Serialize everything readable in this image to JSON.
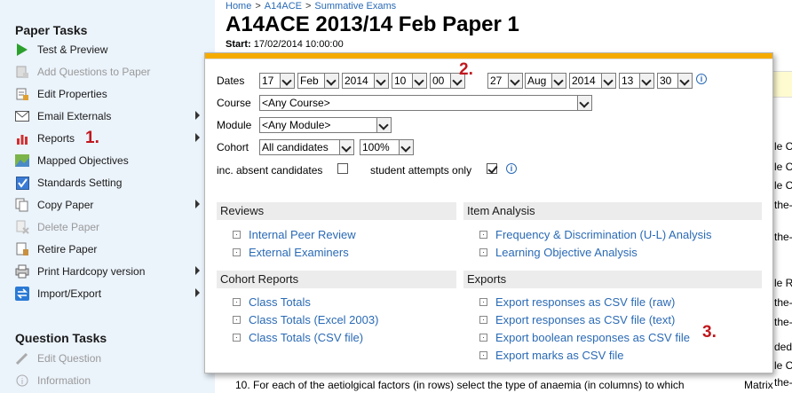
{
  "breadcrumb": {
    "items": [
      "Home",
      "A14ACE",
      "Summative Exams"
    ]
  },
  "header": {
    "title": "A14ACE 2013/14 Feb Paper 1",
    "start_label": "Start:",
    "start_value": "17/02/2014 10:00:00"
  },
  "sidebar": {
    "paper_tasks_title": "Paper Tasks",
    "paper_items": [
      {
        "label": "Test & Preview",
        "icon": "play-icon",
        "disabled": false,
        "submenu": false
      },
      {
        "label": "Add Questions to Paper",
        "icon": "add-questions-icon",
        "disabled": true,
        "submenu": false
      },
      {
        "label": "Edit Properties",
        "icon": "edit-properties-icon",
        "disabled": false,
        "submenu": false
      },
      {
        "label": "Email Externals",
        "icon": "email-icon",
        "disabled": false,
        "submenu": true
      },
      {
        "label": "Reports",
        "icon": "bar-chart-icon",
        "disabled": false,
        "submenu": true
      },
      {
        "label": "Mapped Objectives",
        "icon": "map-icon",
        "disabled": false,
        "submenu": false
      },
      {
        "label": "Standards Setting",
        "icon": "checkbox-icon",
        "disabled": false,
        "submenu": false
      },
      {
        "label": "Copy Paper",
        "icon": "copy-icon",
        "disabled": false,
        "submenu": true
      },
      {
        "label": "Delete Paper",
        "icon": "delete-icon",
        "disabled": true,
        "submenu": false
      },
      {
        "label": "Retire Paper",
        "icon": "retire-icon",
        "disabled": false,
        "submenu": false
      },
      {
        "label": "Print Hardcopy version",
        "icon": "print-icon",
        "disabled": false,
        "submenu": true
      },
      {
        "label": "Import/Export",
        "icon": "import-export-icon",
        "disabled": false,
        "submenu": true
      }
    ],
    "question_tasks_title": "Question Tasks",
    "question_items": [
      {
        "label": "Edit Question",
        "icon": "pencil-icon",
        "disabled": true
      },
      {
        "label": "Information",
        "icon": "info-icon",
        "disabled": true
      }
    ]
  },
  "annotations": {
    "one": "1.",
    "two": "2.",
    "three": "3."
  },
  "filters": {
    "dates_label": "Dates",
    "from": {
      "day": "17",
      "month": "Feb",
      "year": "2014",
      "hour": "10",
      "minute": "00"
    },
    "to": {
      "day": "27",
      "month": "Aug",
      "year": "2014",
      "hour": "13",
      "minute": "30"
    },
    "course_label": "Course",
    "course_value": "<Any Course>",
    "module_label": "Module",
    "module_value": "<Any Module>",
    "cohort_label": "Cohort",
    "cohort_value": "All candidates",
    "percent_value": "100%",
    "absent_label": "inc. absent candidates",
    "absent_checked": false,
    "student_attempts_label": "student attempts only",
    "student_attempts_checked": true
  },
  "panels": {
    "reviews": {
      "title": "Reviews",
      "links": [
        "Internal Peer Review",
        "External Examiners"
      ]
    },
    "item_analysis": {
      "title": "Item Analysis",
      "links": [
        "Frequency & Discrimination (U-L) Analysis",
        "Learning Objective Analysis"
      ]
    },
    "cohort_reports": {
      "title": "Cohort Reports",
      "links": [
        "Class Totals",
        "Class Totals (Excel 2003)",
        "Class Totals (CSV file)"
      ]
    },
    "exports": {
      "title": "Exports",
      "links": [
        "Export responses as CSV file (raw)",
        "Export responses as CSV file (text)",
        "Export boolean responses as CSV file",
        "Export marks as CSV file"
      ]
    }
  },
  "background": {
    "question_text": "10.  For each of the aetiolgical factors (in rows) select the type of anaemia (in columns) to which",
    "matrix_label": "Matrix",
    "right_fragments": [
      "le C",
      "le C",
      "le C",
      "the-",
      "the-",
      "le R",
      "the-",
      "the-",
      "ded",
      "le C",
      "the-"
    ]
  },
  "colors": {
    "accent": "#f5aa00",
    "link": "#2a6ab5",
    "badge": "#c0181e",
    "sidebar_bg": "#ebf3fb"
  }
}
